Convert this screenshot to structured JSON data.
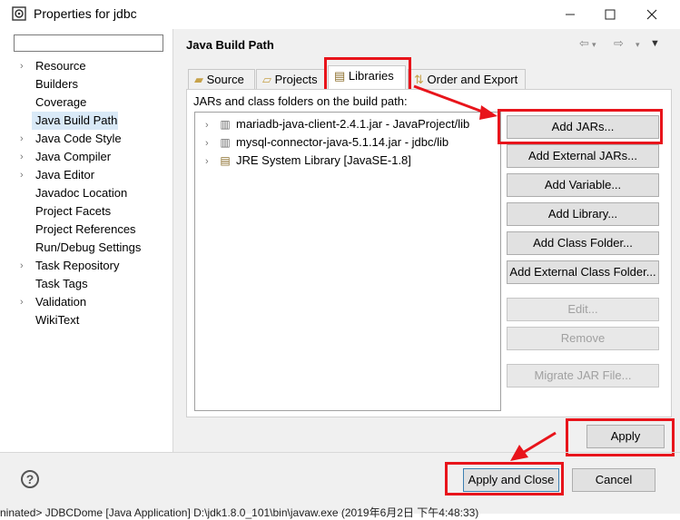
{
  "window": {
    "title": "Properties for jdbc",
    "minimize_icon": "minimize-icon",
    "maximize_icon": "maximize-icon",
    "close_icon": "close-icon"
  },
  "sidebar": {
    "filter_placeholder": "",
    "items": [
      {
        "label": "Resource",
        "expandable": true
      },
      {
        "label": "Builders",
        "expandable": false
      },
      {
        "label": "Coverage",
        "expandable": false
      },
      {
        "label": "Java Build Path",
        "expandable": false,
        "selected": true
      },
      {
        "label": "Java Code Style",
        "expandable": true
      },
      {
        "label": "Java Compiler",
        "expandable": true
      },
      {
        "label": "Java Editor",
        "expandable": true
      },
      {
        "label": "Javadoc Location",
        "expandable": false
      },
      {
        "label": "Project Facets",
        "expandable": false
      },
      {
        "label": "Project References",
        "expandable": false
      },
      {
        "label": "Run/Debug Settings",
        "expandable": false
      },
      {
        "label": "Task Repository",
        "expandable": true
      },
      {
        "label": "Task Tags",
        "expandable": false
      },
      {
        "label": "Validation",
        "expandable": true
      },
      {
        "label": "WikiText",
        "expandable": false
      }
    ]
  },
  "page": {
    "title": "Java Build Path",
    "tabs": [
      {
        "label": "Source",
        "icon": "source-folder-icon"
      },
      {
        "label": "Projects",
        "icon": "projects-icon"
      },
      {
        "label": "Libraries",
        "icon": "libraries-icon",
        "active": true
      },
      {
        "label": "Order and Export",
        "icon": "order-export-icon"
      }
    ],
    "list_label": "JARs and class folders on the build path:",
    "entries": [
      {
        "label": "mariadb-java-client-2.4.1.jar - JavaProject/lib",
        "icon": "jar-icon"
      },
      {
        "label": "mysql-connector-java-5.1.14.jar - jdbc/lib",
        "icon": "jar-icon"
      },
      {
        "label": "JRE System Library [JavaSE-1.8]",
        "icon": "library-icon"
      }
    ],
    "buttons": {
      "add_jars": "Add JARs...",
      "add_external_jars": "Add External JARs...",
      "add_variable": "Add Variable...",
      "add_library": "Add Library...",
      "add_class_folder": "Add Class Folder...",
      "add_external_class_folder": "Add External Class Folder...",
      "edit": "Edit...",
      "remove": "Remove",
      "migrate": "Migrate JAR File..."
    }
  },
  "footer": {
    "apply": "Apply",
    "apply_and_close": "Apply and Close",
    "cancel": "Cancel",
    "help_icon": "help-icon"
  },
  "status_bar": {
    "text": "ninated> JDBCDome [Java Application] D:\\jdk1.8.0_101\\bin\\javaw.exe (2019年6月2日 下午4:48:33)"
  },
  "colors": {
    "highlight_red": "#e8141b",
    "selection": "#d9e9f7"
  }
}
